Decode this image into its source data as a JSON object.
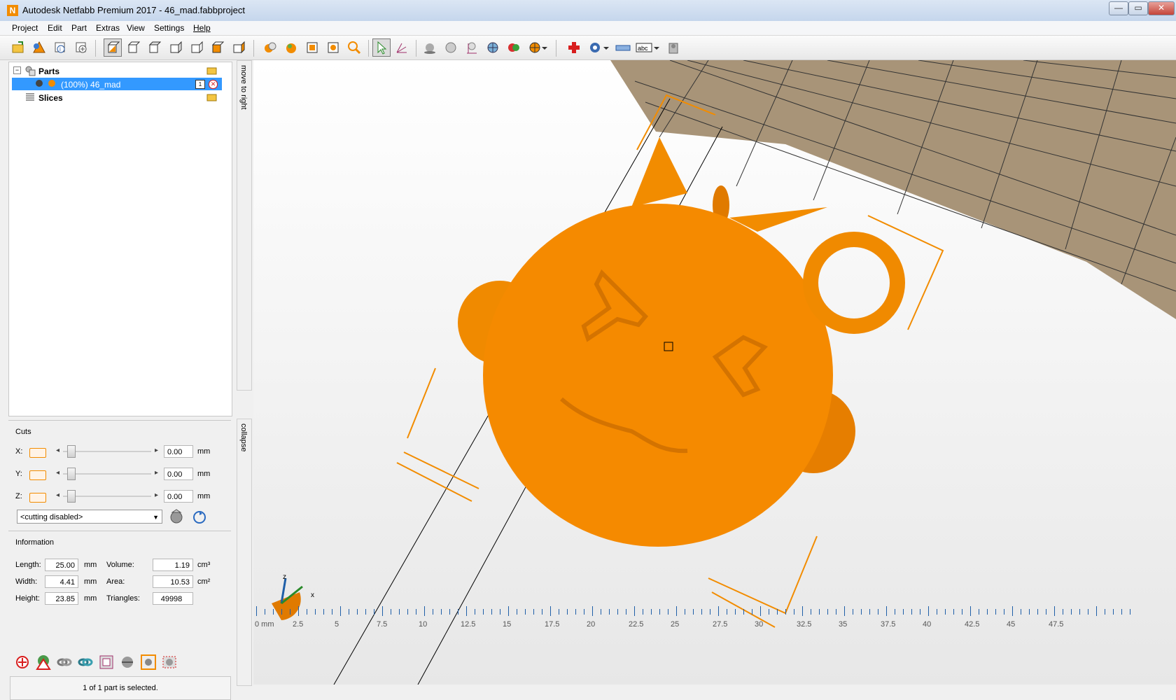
{
  "window": {
    "title": "Autodesk Netfabb Premium 2017 - 46_mad.fabbproject",
    "app_icon_letter": "N",
    "controls": {
      "minimize": "—",
      "maximize": "▭",
      "close": "✕"
    }
  },
  "menu": [
    "Project",
    "Edit",
    "Part",
    "Extras",
    "View",
    "Settings",
    "Help"
  ],
  "toolbar": {
    "icons": [
      "open-project-icon",
      "add-part-icon",
      "add-part-info-icon",
      "new-part-icon",
      "view-default-icon",
      "view-front-icon",
      "view-back-icon",
      "view-left-icon",
      "view-right-icon",
      "view-top-icon",
      "view-bottom-icon",
      "multi-parts-icon",
      "part-color-icon",
      "fit-view-icon",
      "zoom-fit-icon",
      "zoom-icon",
      "select-pointer-icon",
      "measure-axes-icon",
      "shade-icon",
      "sphere-icon",
      "points-icon",
      "mesh-icon",
      "colors-icon",
      "sphere-half-icon",
      "repair-icon",
      "analysis-icon",
      "ruler-icon",
      "label-icon",
      "settings-icon"
    ]
  },
  "sidebar": {
    "tree": {
      "parts_label": "Parts",
      "part_item_label": "(100%) 46_mad",
      "part_item_count": "1",
      "slices_label": "Slices"
    },
    "vtabs": {
      "move_to_right": "move to right",
      "collapse": "collapse"
    },
    "cuts": {
      "title": "Cuts",
      "axes": [
        {
          "label": "X:",
          "value": "0.00",
          "unit": "mm"
        },
        {
          "label": "Y:",
          "value": "0.00",
          "unit": "mm"
        },
        {
          "label": "Z:",
          "value": "0.00",
          "unit": "mm"
        }
      ],
      "mode_value": "<cutting disabled>"
    },
    "information": {
      "title": "Information",
      "length": {
        "label": "Length:",
        "value": "25.00",
        "unit": "mm"
      },
      "width": {
        "label": "Width:",
        "value": "4.41",
        "unit": "mm"
      },
      "height": {
        "label": "Height:",
        "value": "23.85",
        "unit": "mm"
      },
      "volume": {
        "label": "Volume:",
        "value": "1.19",
        "unit": "cm³"
      },
      "area": {
        "label": "Area:",
        "value": "10.53",
        "unit": "cm²"
      },
      "triangles": {
        "label": "Triangles:",
        "value": "49998"
      }
    },
    "status": "1 of 1 part is selected.",
    "bottom_icons": [
      "repair-gear-icon",
      "warning-icon",
      "link-icon",
      "refresh-icon",
      "frame-icon",
      "sphere-tool-icon",
      "box-tool-icon",
      "settings-tool-icon"
    ]
  },
  "viewport": {
    "ruler_labels": [
      "0 mm",
      "2.5",
      "5",
      "7.5",
      "10",
      "12.5",
      "15",
      "17.5",
      "20",
      "22.5",
      "25",
      "27.5",
      "30",
      "32.5",
      "35",
      "37.5",
      "40",
      "42.5",
      "45",
      "47.5"
    ],
    "axis_x_label": "x",
    "axis_z_label": "z",
    "colors": {
      "part": "#f28c00",
      "plate": "#a89478",
      "grid_line": "#333333"
    }
  }
}
